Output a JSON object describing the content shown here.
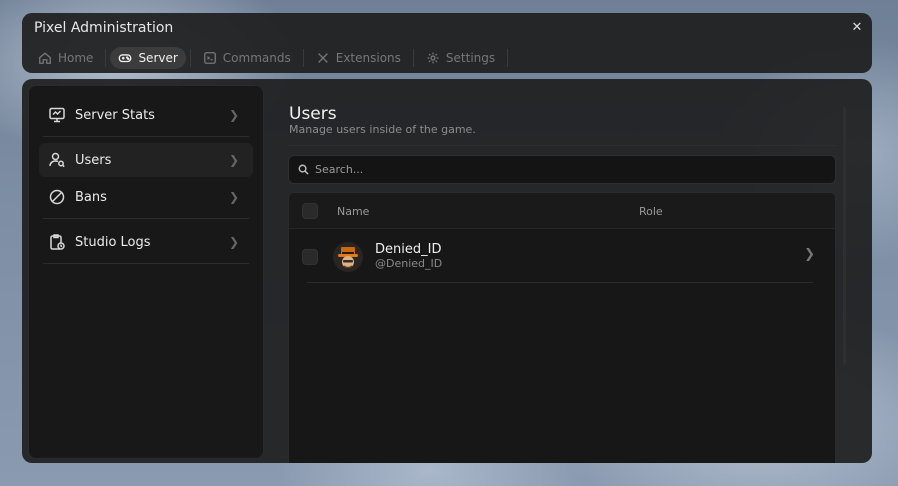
{
  "window": {
    "title": "Pixel Administration",
    "close_icon": "close-icon"
  },
  "tabs": [
    {
      "label": "Home",
      "icon": "home-icon",
      "active": false
    },
    {
      "label": "Server",
      "icon": "gamepad-icon",
      "active": true
    },
    {
      "label": "Commands",
      "icon": "commands-icon",
      "active": false
    },
    {
      "label": "Extensions",
      "icon": "tools-icon",
      "active": false
    },
    {
      "label": "Settings",
      "icon": "gear-icon",
      "active": false
    }
  ],
  "sidebar": {
    "items": [
      {
        "label": "Server Stats",
        "icon": "monitor-icon",
        "active": false
      },
      {
        "label": "Users",
        "icon": "user-search-icon",
        "active": true
      },
      {
        "label": "Bans",
        "icon": "ban-icon",
        "active": false
      },
      {
        "label": "Studio Logs",
        "icon": "clipboard-clock-icon",
        "active": false
      }
    ]
  },
  "main": {
    "title": "Users",
    "subtitle": "Manage users inside of the game.",
    "search": {
      "placeholder": "Search..."
    },
    "table": {
      "columns": [
        "Name",
        "Role"
      ],
      "rows": [
        {
          "display_name": "Denied_ID",
          "handle": "@Denied_ID",
          "role": ""
        }
      ]
    }
  },
  "colors": {
    "accent_bg": "#3c3c3c",
    "panel": "#1c1c1c"
  }
}
